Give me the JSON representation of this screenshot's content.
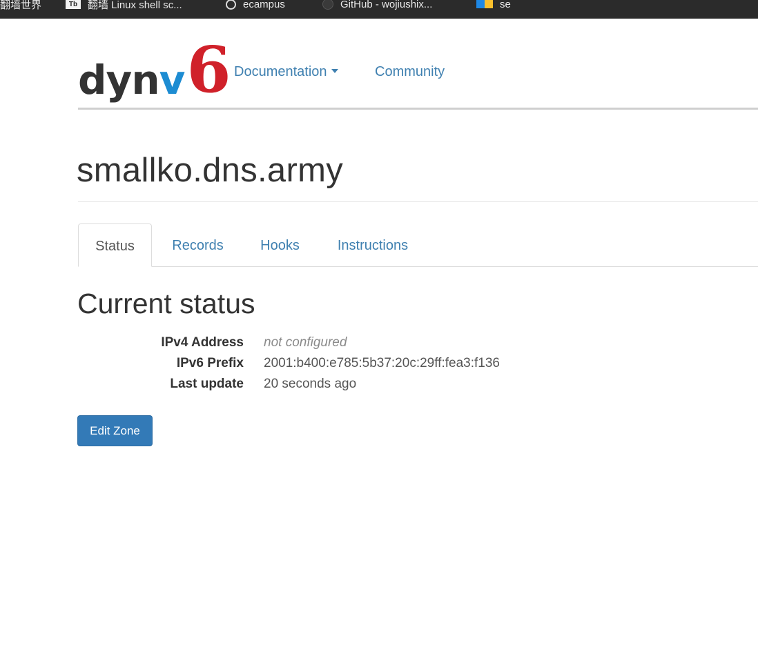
{
  "bookmarks": [
    {
      "icon": "globe-icon",
      "label": "翻墙世界"
    },
    {
      "icon": "document-icon",
      "badge": "Tb",
      "label": "翻墙 Linux shell sc..."
    },
    {
      "icon": "globe-icon",
      "label": "ecampus"
    },
    {
      "icon": "github-icon",
      "label": "GitHub - wojiushix..."
    },
    {
      "icon": "microsoft-icon",
      "label": "se"
    }
  ],
  "header": {
    "logo": {
      "part1": "dyn",
      "part2": "v",
      "part3": "6"
    },
    "nav": {
      "documentation": "Documentation",
      "community": "Community"
    }
  },
  "zone": {
    "title": "smallko.dns.army"
  },
  "tabs": [
    {
      "label": "Status",
      "active": true
    },
    {
      "label": "Records",
      "active": false
    },
    {
      "label": "Hooks",
      "active": false
    },
    {
      "label": "Instructions",
      "active": false
    }
  ],
  "status": {
    "heading": "Current status",
    "rows": [
      {
        "label": "IPv4 Address",
        "value": "not configured"
      },
      {
        "label": "IPv6 Prefix",
        "value": "2001:b400:e785:5b37:20c:29ff:fea3:f136"
      },
      {
        "label": "Last update",
        "value": "20 seconds ago"
      }
    ]
  },
  "actions": {
    "edit_zone": "Edit Zone"
  },
  "colors": {
    "link": "#3f80b0",
    "primary_button": "#337ab7",
    "logo_dark": "#333333",
    "logo_blue": "#1d8cd2",
    "logo_red": "#d0212a"
  }
}
